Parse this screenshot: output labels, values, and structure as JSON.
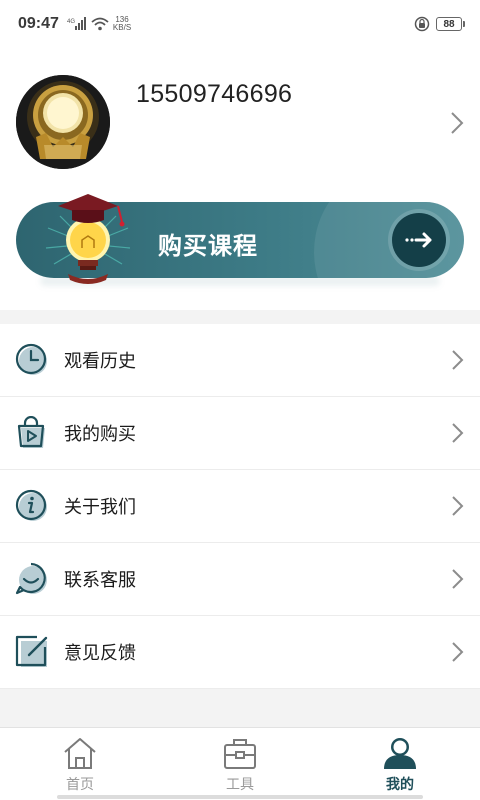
{
  "status_bar": {
    "time": "09:47",
    "network": "4G",
    "speed_value": "136",
    "speed_unit": "KB/S",
    "battery": "88"
  },
  "profile": {
    "phone": "15509746696"
  },
  "banner": {
    "title": "购买课程"
  },
  "menu": {
    "items": [
      {
        "label": "观看历史",
        "icon": "clock-icon"
      },
      {
        "label": "我的购买",
        "icon": "shopping-bag-play-icon"
      },
      {
        "label": "关于我们",
        "icon": "info-icon"
      },
      {
        "label": "联系客服",
        "icon": "chat-smile-icon"
      },
      {
        "label": "意见反馈",
        "icon": "edit-feedback-icon"
      }
    ]
  },
  "tabbar": {
    "tabs": [
      {
        "label": "首页",
        "icon": "home-icon",
        "active": false
      },
      {
        "label": "工具",
        "icon": "toolbox-icon",
        "active": false
      },
      {
        "label": "我的",
        "icon": "user-icon",
        "active": true
      }
    ]
  },
  "colors": {
    "accent": "#1f4f5a",
    "banner": "#3d7b86",
    "icon_fill": "#b8cdd4"
  }
}
